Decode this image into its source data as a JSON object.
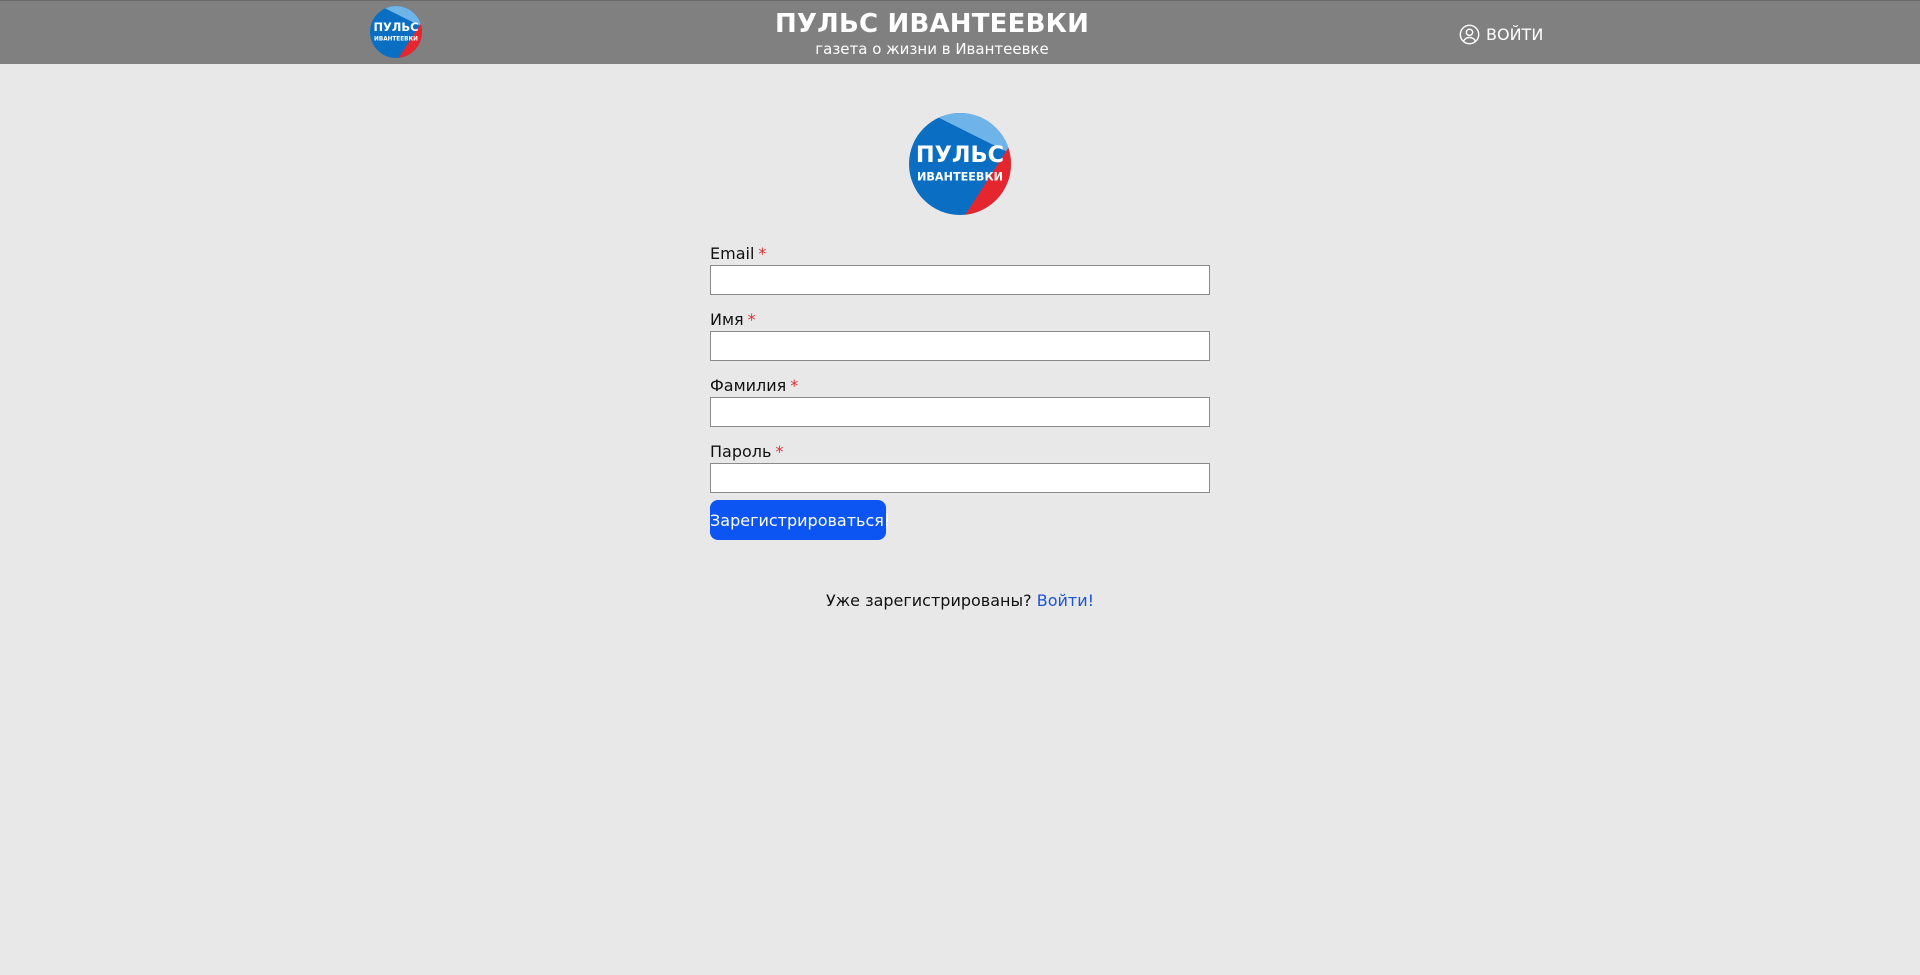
{
  "header": {
    "title": "ПУЛЬС ИВАНТЕЕВКИ",
    "subtitle": "газета о жизни в Ивантеевке",
    "login_label": "ВОЙТИ",
    "logo_text_line1": "ПУЛЬС",
    "logo_text_line2": "ИВАНТЕЕВКИ"
  },
  "form": {
    "fields": [
      {
        "label": "Email",
        "required_mark": "*",
        "value": ""
      },
      {
        "label": "Имя",
        "required_mark": "*",
        "value": ""
      },
      {
        "label": "Фамилия",
        "required_mark": "*",
        "value": ""
      },
      {
        "label": "Пароль",
        "required_mark": "*",
        "value": ""
      }
    ],
    "submit_label": "Зарегистрироваться!"
  },
  "footer_prompt": {
    "text": "Уже зарегистрированы?",
    "link_label": "Войти!"
  },
  "colors": {
    "header_bg": "#808080",
    "page_bg": "#e8e8e8",
    "button_bg": "#0d55f2",
    "link": "#1a55d6",
    "required": "#e03030",
    "logo_blue": "#0a6fc2",
    "logo_red": "#e5262f"
  },
  "icons": {
    "login": "user-circle-icon"
  }
}
